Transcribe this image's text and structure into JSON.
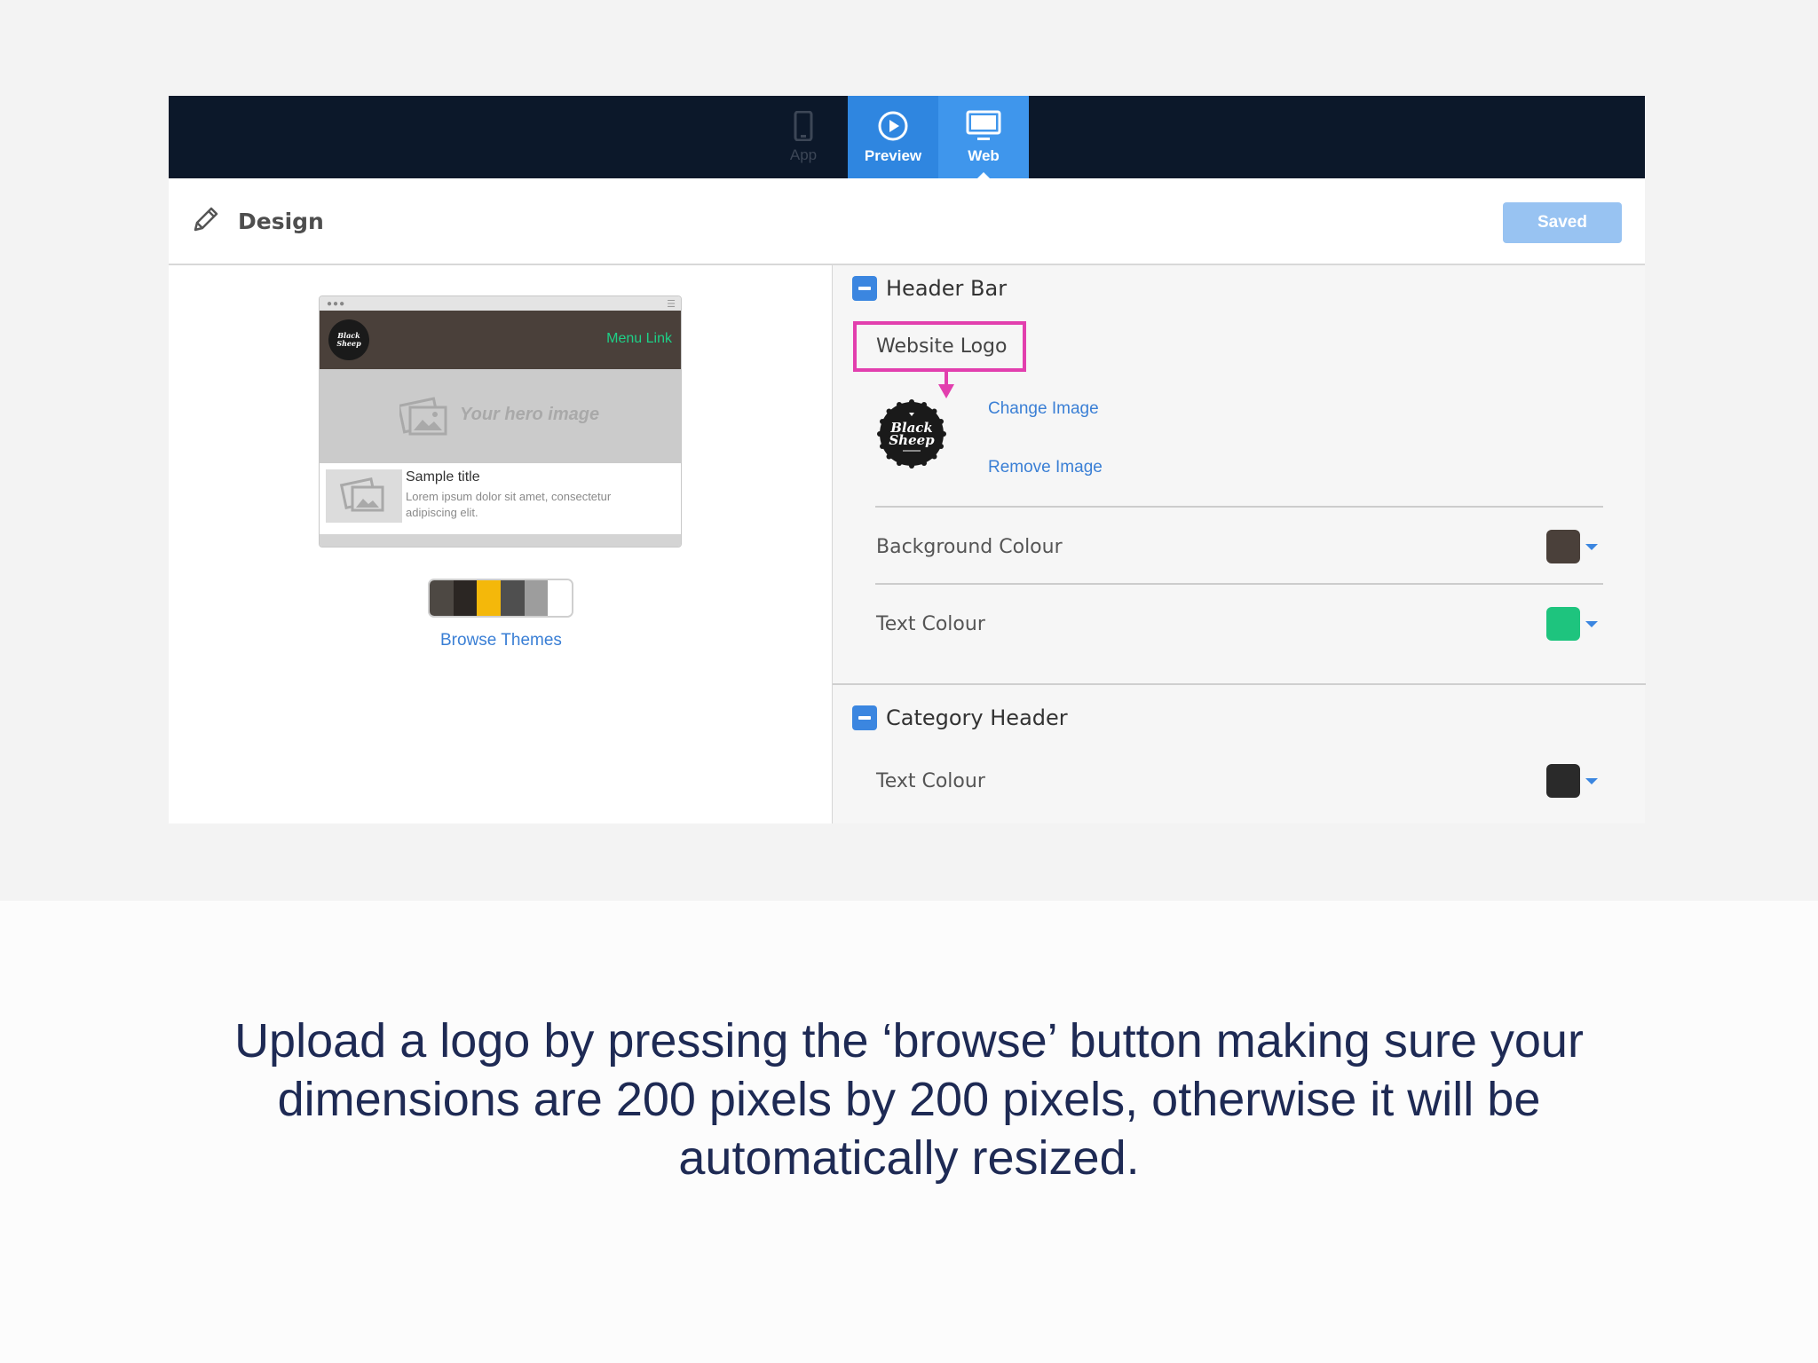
{
  "topbar": {
    "tabs": [
      {
        "label": "App",
        "icon": "phone-icon",
        "active": false
      },
      {
        "label": "Preview",
        "icon": "play-icon",
        "active": false
      },
      {
        "label": "Web",
        "icon": "monitor-icon",
        "active": true
      }
    ]
  },
  "designbar": {
    "title": "Design",
    "icon": "pencil-icon",
    "saved_label": "Saved"
  },
  "preview": {
    "logo_text": "Black Sheep",
    "menu_link": "Menu Link",
    "hero_text": "Your hero image",
    "card_title": "Sample title",
    "card_body": "Lorem ipsum dolor sit amet, consectetur adipiscing elit.",
    "theme_colors": [
      "#4d4843",
      "#2b2623",
      "#f4b80a",
      "#4f4f4f",
      "#9d9d9d",
      "#ffffff"
    ],
    "browse_themes": "Browse Themes"
  },
  "settings": {
    "header_bar": {
      "title": "Header Bar",
      "logo_label": "Website Logo",
      "logo_text": "Black Sheep",
      "change_image": "Change Image",
      "remove_image": "Remove Image",
      "background_colour_label": "Background Colour",
      "background_colour": "#4a403a",
      "text_colour_label": "Text Colour",
      "text_colour": "#1ec47e"
    },
    "category_header": {
      "title": "Category Header",
      "text_colour_label": "Text Colour",
      "text_colour": "#2a2a2a"
    }
  },
  "accent_colors": {
    "highlight": "#e23fae",
    "primary_blue": "#3b86e0",
    "topbar": "#0c182a"
  },
  "caption": "Upload a logo by pressing the ‘browse’ button making sure your dimensions are 200 pixels by 200 pixels, otherwise it will be automatically resized."
}
